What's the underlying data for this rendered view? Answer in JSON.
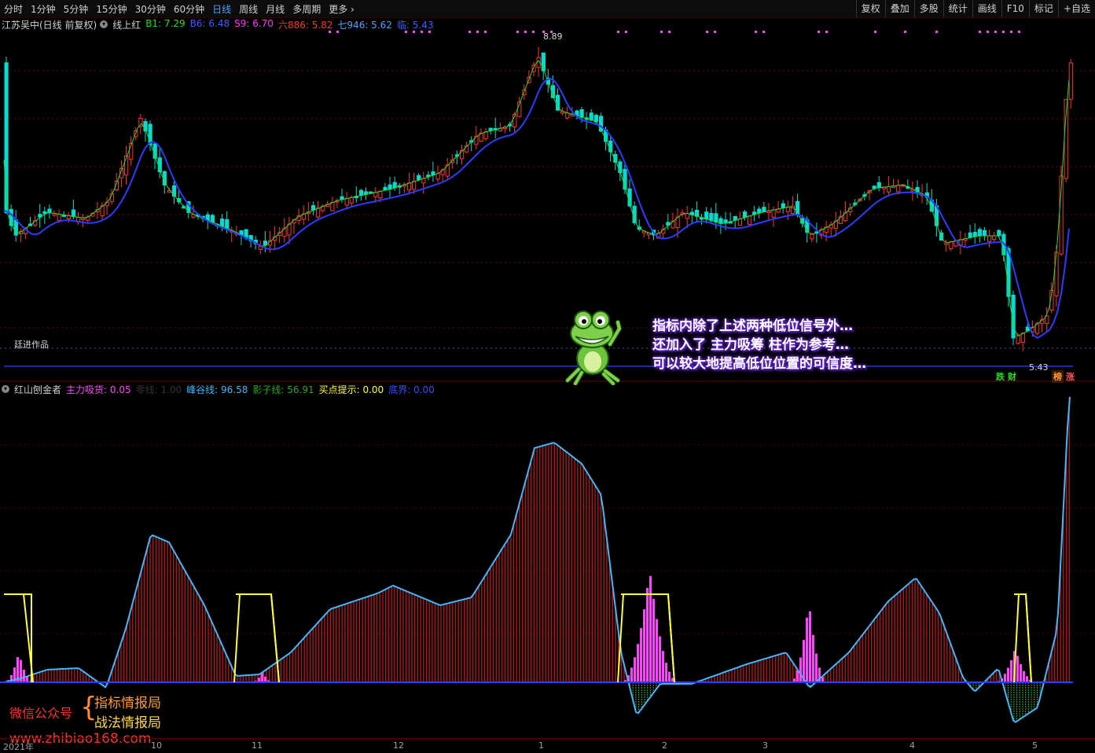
{
  "toolbar": {
    "periods": [
      "分时",
      "1分钟",
      "5分钟",
      "15分钟",
      "30分钟",
      "60分钟",
      "日线",
      "周线",
      "月线",
      "多周期",
      "更多"
    ],
    "active": "日线",
    "more_arrow": "›",
    "right_tools": [
      "复权",
      "叠加",
      "多股",
      "统计",
      "画线",
      "F10",
      "标记",
      "+自选"
    ]
  },
  "main_panel": {
    "stock_title": "江苏吴中(日线 前复权)",
    "indicator_name": "线上红",
    "values": [
      {
        "label": "B1: 7.29",
        "color": "#22dd22"
      },
      {
        "label": "B6: 6.48",
        "color": "#3a5cff"
      },
      {
        "label": "S9: 6.70",
        "color": "#ff33ff"
      },
      {
        "label": "六886: 5.82",
        "color": "#ff3030"
      },
      {
        "label": "七946: 5.62",
        "color": "#4ea3ff"
      },
      {
        "label": "临: 5.43",
        "color": "#3060ff"
      }
    ],
    "high_label": "8.89",
    "low_label": "5.43",
    "author_label": "廷进作品",
    "tag_die": "跌",
    "tag_cai": "财",
    "tag_bang": "榜",
    "tag_zhang": "涨"
  },
  "callout": {
    "line1": "指标内除了上述两种低位信号外…",
    "line2": "还加入了 主力吸筹 柱作为参考…",
    "line3": "可以较大地提高低位位置的可信度…"
  },
  "sub_panel": {
    "indicator_name": "红山刨金者",
    "values": [
      {
        "label": "主力吸货: 0.05",
        "color": "#ff44ff"
      },
      {
        "label": "零线: 1.00",
        "color": "#333333"
      },
      {
        "label": "峰谷线: 96.58",
        "color": "#3fb8ff"
      },
      {
        "label": "影子线: 56.91",
        "color": "#22aa22"
      },
      {
        "label": "买点提示: 0.00",
        "color": "#ffff33"
      },
      {
        "label": "底界: 0.00",
        "color": "#3050ff"
      }
    ]
  },
  "watermark": {
    "wechat": "微信公众号",
    "brace": "{",
    "line1": "指标情报局",
    "line2": "战法情报局",
    "url": "www.zhibiao168.com"
  },
  "xaxis": {
    "labels": [
      "2021年",
      "10",
      "11",
      "12",
      "1",
      "2",
      "3",
      "4",
      "5"
    ]
  },
  "colors": {
    "up": "#ff3333",
    "down": "#00ddd0",
    "ma_short": "#22dd22",
    "ma_long": "#2a3cff",
    "peak_line": "#3fb8ff",
    "buy_hint": "#ffff33",
    "absorb": "#ff44ff"
  },
  "chart_data": {
    "type": "candlestick",
    "title": "江苏吴中(日线 前复权)",
    "price_high": 8.89,
    "price_low": 5.43,
    "price_last_points": [
      5.43,
      5.82,
      6.48,
      7.29,
      8.6
    ]
  }
}
